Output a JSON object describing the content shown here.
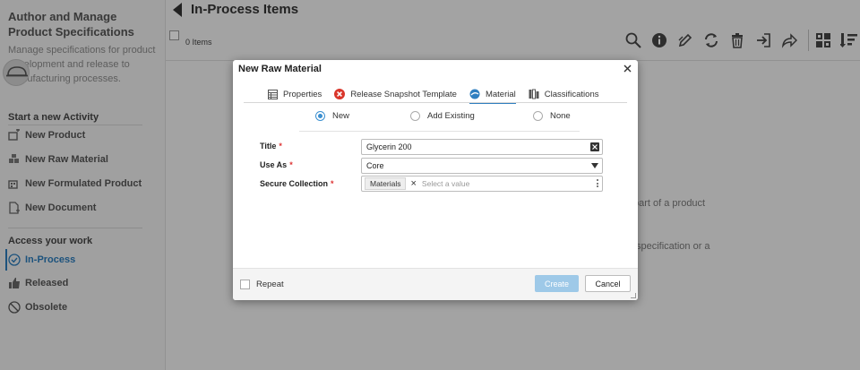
{
  "sidebar": {
    "title": "Author and Manage Product Specifications",
    "description": "Manage specifications for product development and release to manufacturing processes.",
    "start_section": "Start a new Activity",
    "start_items": [
      {
        "label": "New Product",
        "icon": "new-product-icon"
      },
      {
        "label": "New Raw Material",
        "icon": "new-raw-material-icon"
      },
      {
        "label": "New Formulated Product",
        "icon": "new-formulated-product-icon"
      },
      {
        "label": "New Document",
        "icon": "new-document-icon"
      }
    ],
    "access_section": "Access your work",
    "access_items": [
      {
        "label": "In-Process",
        "icon": "check-circle-icon",
        "active": true
      },
      {
        "label": "Released",
        "icon": "thumbs-up-icon"
      },
      {
        "label": "Obsolete",
        "icon": "no-entry-icon"
      }
    ]
  },
  "main": {
    "title": "In-Process Items",
    "items_count": "0 Items",
    "bg_line1": "part of a product",
    "bg_line2": "specification or a"
  },
  "toolbar": {
    "icons": [
      "search-icon",
      "info-icon",
      "edit-icon",
      "refresh-icon",
      "delete-icon",
      "import-icon",
      "share-icon",
      "grid-view-icon",
      "sort-icon"
    ]
  },
  "dialog": {
    "title": "New Raw Material",
    "tabs": [
      {
        "label": "Properties",
        "icon": "properties-icon"
      },
      {
        "label": "Release Snapshot Template",
        "icon": "error-icon"
      },
      {
        "label": "Material",
        "icon": "material-icon",
        "active": true
      },
      {
        "label": "Classifications",
        "icon": "classifications-icon"
      }
    ],
    "radios": [
      {
        "label": "New",
        "checked": true
      },
      {
        "label": "Add Existing",
        "checked": false
      },
      {
        "label": "None",
        "checked": false
      }
    ],
    "fields": {
      "title_label": "Title",
      "title_value": "Glycerin 200",
      "use_as_label": "Use As",
      "use_as_value": "Core",
      "secure_label": "Secure Collection",
      "secure_chip": "Materials",
      "secure_placeholder": "Select a value"
    },
    "footer": {
      "repeat_label": "Repeat",
      "create_label": "Create",
      "cancel_label": "Cancel"
    }
  },
  "colors": {
    "accent": "#2f7fc0",
    "create_button": "#9ec9e8",
    "required": "#dd3333",
    "error_tab_icon": "#d9362b"
  }
}
